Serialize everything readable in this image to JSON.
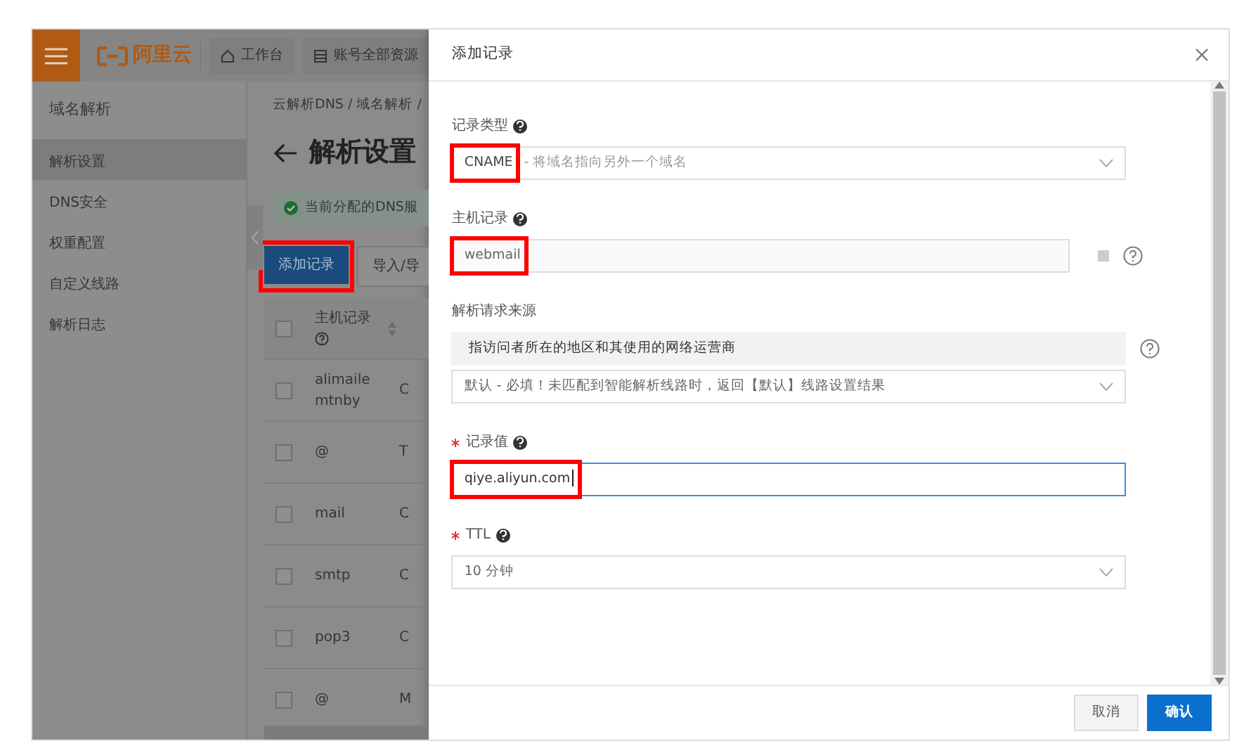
{
  "header": {
    "logo": "阿里云",
    "nav": [
      {
        "label": "工作台",
        "kind": "home"
      },
      {
        "label": "账号全部资源",
        "kind": "list"
      }
    ]
  },
  "sidebar": {
    "title": "域名解析",
    "items": [
      {
        "label": "解析设置",
        "selected": true
      },
      {
        "label": "DNS安全",
        "selected": false
      },
      {
        "label": "权重配置",
        "selected": false
      },
      {
        "label": "自定义线路",
        "selected": false
      },
      {
        "label": "解析日志",
        "selected": false
      }
    ]
  },
  "main": {
    "breadcrumb": "云解析DNS / 域名解析 /",
    "title": "解析设置",
    "alert": "当前分配的DNS服",
    "buttons": [
      {
        "label": "添加记录",
        "primary": true,
        "highlighted": true
      },
      {
        "label": "导入/导",
        "primary": false,
        "highlighted": false
      }
    ],
    "table": {
      "columns": [
        {
          "label": "主机记录"
        }
      ],
      "header_checked": false,
      "rows": [
        {
          "host": "alimailemtnby",
          "column_3": "C",
          "checked": false
        },
        {
          "host": "@",
          "column_3": "T",
          "checked": false
        },
        {
          "host": "mail",
          "column_3": "C",
          "checked": false
        },
        {
          "host": "smtp",
          "column_3": "C",
          "checked": false
        },
        {
          "host": "pop3",
          "column_3": "C",
          "checked": false
        },
        {
          "host": "@",
          "column_3": "M",
          "checked": false
        }
      ]
    }
  },
  "dialog": {
    "title": "添加记录",
    "fields": [
      {
        "kind": "select",
        "label": "记录类型",
        "help": true,
        "required": false,
        "value": "CNAME",
        "description": "- 将域名指向另外一个域名",
        "highlighted": true
      },
      {
        "kind": "input",
        "label": "主机记录",
        "help": true,
        "required": false,
        "value": "webmail",
        "suffix": true,
        "side_help": true,
        "highlighted": true,
        "focused": false
      },
      {
        "kind": "select",
        "label": "解析请求来源",
        "help": false,
        "required": false,
        "note": "指访问者所在的地区和其使用的网络运营商",
        "side_help": true,
        "value": "默认 - 必填！未匹配到智能解析线路时，返回【默认】线路设置结果",
        "highlighted": false
      },
      {
        "kind": "input",
        "label": "记录值",
        "help": true,
        "required": true,
        "value": "qiye.aliyun.com",
        "highlighted": true,
        "focused": true
      },
      {
        "kind": "select",
        "label": "TTL",
        "help": true,
        "required": true,
        "value": "10 分钟",
        "highlighted": false
      }
    ],
    "buttons": [
      {
        "label": "取消",
        "primary": false
      },
      {
        "label": "确认",
        "primary": true
      }
    ]
  }
}
